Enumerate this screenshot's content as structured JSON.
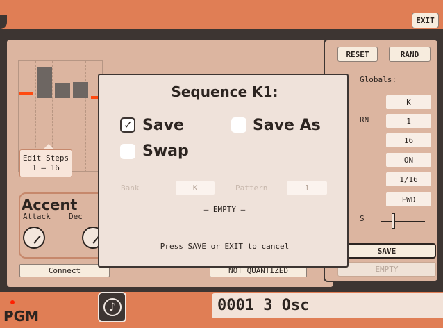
{
  "header": {
    "exit_label": "EXIT"
  },
  "editor": {
    "edit_steps_line1": "Edit Steps",
    "edit_steps_line2": "1 – 16",
    "accent_title": "Accent",
    "attack_label": "Attack",
    "decay_label": "Dec",
    "connect_label": "Connect",
    "quantize_label": "NOT QUANTIZED"
  },
  "right_panel": {
    "reset_label": "RESET",
    "rand_label": "RAND",
    "globals_label": "Globals:",
    "values": [
      "K",
      "1",
      "16",
      "ON",
      "1/16",
      "FWD"
    ],
    "rn_label": "RN",
    "s_label": "S",
    "save_label": "SAVE",
    "empty_label": "EMPTY"
  },
  "dialog": {
    "title": "Sequence K1:",
    "options": {
      "save": {
        "label": "Save",
        "checked": true
      },
      "save_as": {
        "label": "Save As",
        "checked": false
      },
      "swap": {
        "label": "Swap",
        "checked": false
      }
    },
    "bank_label": "Bank",
    "bank_value": "K",
    "pattern_label": "Pattern",
    "pattern_value": "1",
    "empty_text": "– EMPTY –",
    "hint": "Press SAVE or EXIT to cancel"
  },
  "footer": {
    "pgm_label": "PGM",
    "display_text": "0001 3 Osc",
    "note_icon": "note-icon"
  },
  "colors": {
    "accent_orange": "#e07e55",
    "dark": "#3d3532",
    "panel": "#dcb5a0",
    "dialog_bg": "#efe2da",
    "led_red": "#ff2000"
  }
}
